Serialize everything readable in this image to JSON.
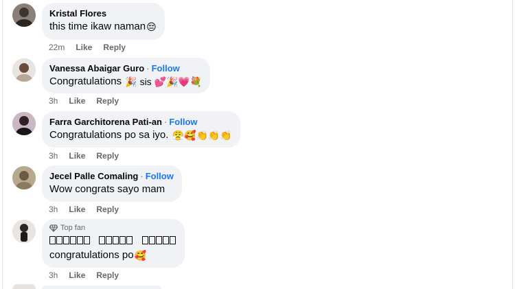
{
  "comments": [
    {
      "name": "Kristal Flores",
      "follow": "",
      "text": "this time ikaw naman",
      "emojis": "😔",
      "time": "22m",
      "like": "Like",
      "reply": "Reply"
    },
    {
      "name": "Vanessa Abaigar Guro",
      "follow": "Follow",
      "text": "Congratulations",
      "emojis": "🎉 sis 💕🎉💗💐",
      "time": "3h",
      "like": "Like",
      "reply": "Reply"
    },
    {
      "name": "Farra Garchitorena Pati-an",
      "follow": "Follow",
      "text": "Congratulations po sa iyo.",
      "emojis": "😤🥰👏👏👏",
      "time": "3h",
      "like": "Like",
      "reply": "Reply"
    },
    {
      "name": "Jecel Palle Comaling",
      "follow": "Follow",
      "text": "Wow congrats sayo mam",
      "emojis": "",
      "time": "3h",
      "like": "Like",
      "reply": "Reply"
    },
    {
      "badge": "Top fan",
      "text": "congratulations po",
      "emojis": "🥰",
      "time": "3h",
      "like": "Like",
      "reply": "Reply"
    }
  ],
  "icons": [
    "diamond-icon"
  ],
  "colors": {
    "bubble": "#f0f2f5",
    "follow": "#1877f2",
    "meta": "#65676b"
  }
}
